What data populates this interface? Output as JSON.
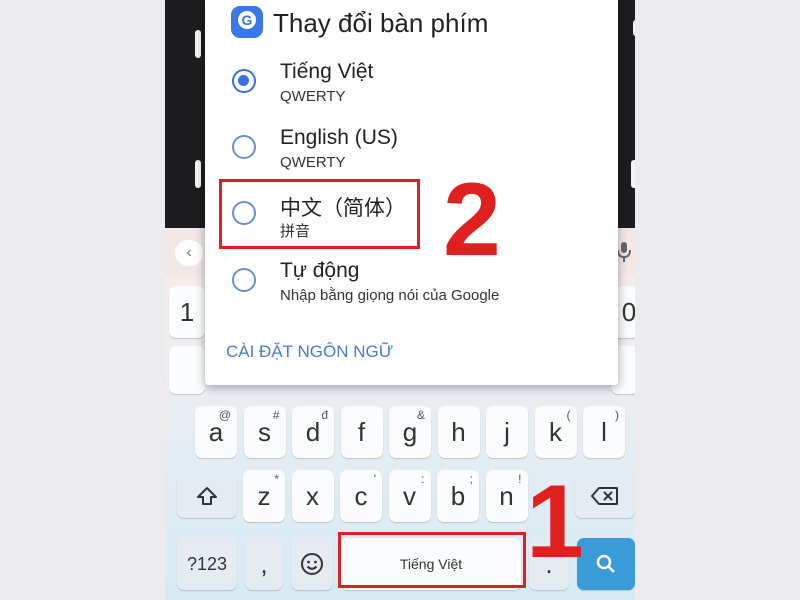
{
  "dialog": {
    "title": "Thay đổi bàn phím",
    "options": [
      {
        "label": "Tiếng Việt",
        "sub": "QWERTY",
        "selected": true
      },
      {
        "label": "English (US)",
        "sub": "QWERTY",
        "selected": false
      },
      {
        "label": "中文（简体）",
        "sub": "拼音",
        "selected": false
      },
      {
        "label": "Tự động",
        "sub": "Nhập bằng giọng nói của Google",
        "selected": false
      }
    ],
    "settings_link": "CÀI ĐẶT NGÔN NGỮ"
  },
  "annotations": {
    "step_one": "1",
    "step_two": "2",
    "highlight_color": "#e02020"
  },
  "keyboard": {
    "partial_left": "1",
    "partial_right": "0",
    "row2": [
      {
        "key": "a",
        "sup": "@"
      },
      {
        "key": "s",
        "sup": "#"
      },
      {
        "key": "d",
        "sup": "đ"
      },
      {
        "key": "f",
        "sup": ""
      },
      {
        "key": "g",
        "sup": "&"
      },
      {
        "key": "h",
        "sup": ""
      },
      {
        "key": "j",
        "sup": ""
      },
      {
        "key": "k",
        "sup": "("
      },
      {
        "key": "l",
        "sup": ")"
      }
    ],
    "row3": [
      {
        "key": "z",
        "sup": "*"
      },
      {
        "key": "x",
        "sup": ""
      },
      {
        "key": "c",
        "sup": "'"
      },
      {
        "key": "v",
        "sup": ":"
      },
      {
        "key": "b",
        "sup": ";"
      },
      {
        "key": "n",
        "sup": "!"
      }
    ],
    "numbers_key": "?123",
    "comma_key": ",",
    "period_key": ".",
    "spacebar": "Tiếng Việt"
  }
}
